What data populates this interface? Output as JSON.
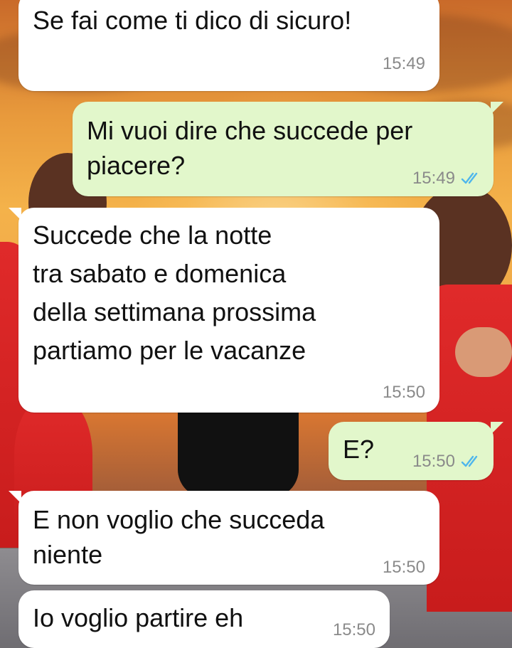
{
  "chat": {
    "messages": [
      {
        "direction": "incoming",
        "text": "Se fai come ti dico di sicuro!",
        "time": "15:49"
      },
      {
        "direction": "outgoing",
        "text": "Mi vuoi dire che succede per\npiacere?",
        "time": "15:49",
        "status": "read"
      },
      {
        "direction": "incoming",
        "text": "Succede che la notte\ntra sabato e domenica\ndella settimana prossima\npartiamo per le vacanze",
        "time": "15:50"
      },
      {
        "direction": "outgoing",
        "text": "E?",
        "time": "15:50",
        "status": "read"
      },
      {
        "direction": "incoming",
        "text": "E non voglio che succeda\nniente",
        "time": "15:50"
      },
      {
        "direction": "incoming",
        "text": "Io voglio partire eh",
        "time": "15:50"
      }
    ]
  },
  "colors": {
    "incoming_bubble": "#ffffff",
    "outgoing_bubble": "#e2f7cb",
    "read_ticks": "#4fb6ec",
    "timestamp": "#8a8a8a"
  },
  "icons": {
    "read_receipt": "double-check-icon"
  }
}
